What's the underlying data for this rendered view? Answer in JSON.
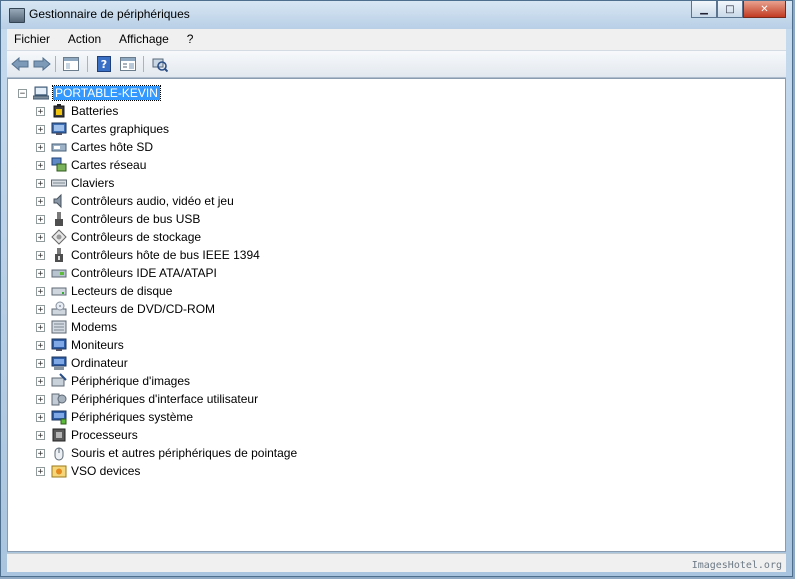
{
  "window": {
    "title": "Gestionnaire de périphériques"
  },
  "menu": [
    "Fichier",
    "Action",
    "Affichage",
    "?"
  ],
  "tree": {
    "root": "PORTABLE-KEVIN",
    "items": [
      {
        "label": "Batteries",
        "icon": "battery-icon"
      },
      {
        "label": "Cartes graphiques",
        "icon": "display-adapter-icon"
      },
      {
        "label": "Cartes hôte SD",
        "icon": "sd-host-icon"
      },
      {
        "label": "Cartes réseau",
        "icon": "network-adapter-icon"
      },
      {
        "label": "Claviers",
        "icon": "keyboard-icon"
      },
      {
        "label": "Contrôleurs audio, vidéo et jeu",
        "icon": "speaker-icon"
      },
      {
        "label": "Contrôleurs de bus USB",
        "icon": "usb-icon"
      },
      {
        "label": "Contrôleurs de stockage",
        "icon": "storage-controller-icon"
      },
      {
        "label": "Contrôleurs hôte de bus IEEE 1394",
        "icon": "ieee1394-icon"
      },
      {
        "label": "Contrôleurs IDE ATA/ATAPI",
        "icon": "ide-controller-icon"
      },
      {
        "label": "Lecteurs de disque",
        "icon": "disk-drive-icon"
      },
      {
        "label": "Lecteurs de DVD/CD-ROM",
        "icon": "dvd-drive-icon"
      },
      {
        "label": "Modems",
        "icon": "modem-icon"
      },
      {
        "label": "Moniteurs",
        "icon": "monitor-icon"
      },
      {
        "label": "Ordinateur",
        "icon": "computer-icon"
      },
      {
        "label": "Périphérique d'images",
        "icon": "imaging-device-icon"
      },
      {
        "label": "Périphériques d'interface utilisateur",
        "icon": "hid-icon"
      },
      {
        "label": "Périphériques système",
        "icon": "system-device-icon"
      },
      {
        "label": "Processeurs",
        "icon": "processor-icon"
      },
      {
        "label": "Souris et autres périphériques de pointage",
        "icon": "mouse-icon"
      },
      {
        "label": "VSO devices",
        "icon": "vso-device-icon"
      }
    ]
  },
  "watermark": "ImagesHotel.org"
}
